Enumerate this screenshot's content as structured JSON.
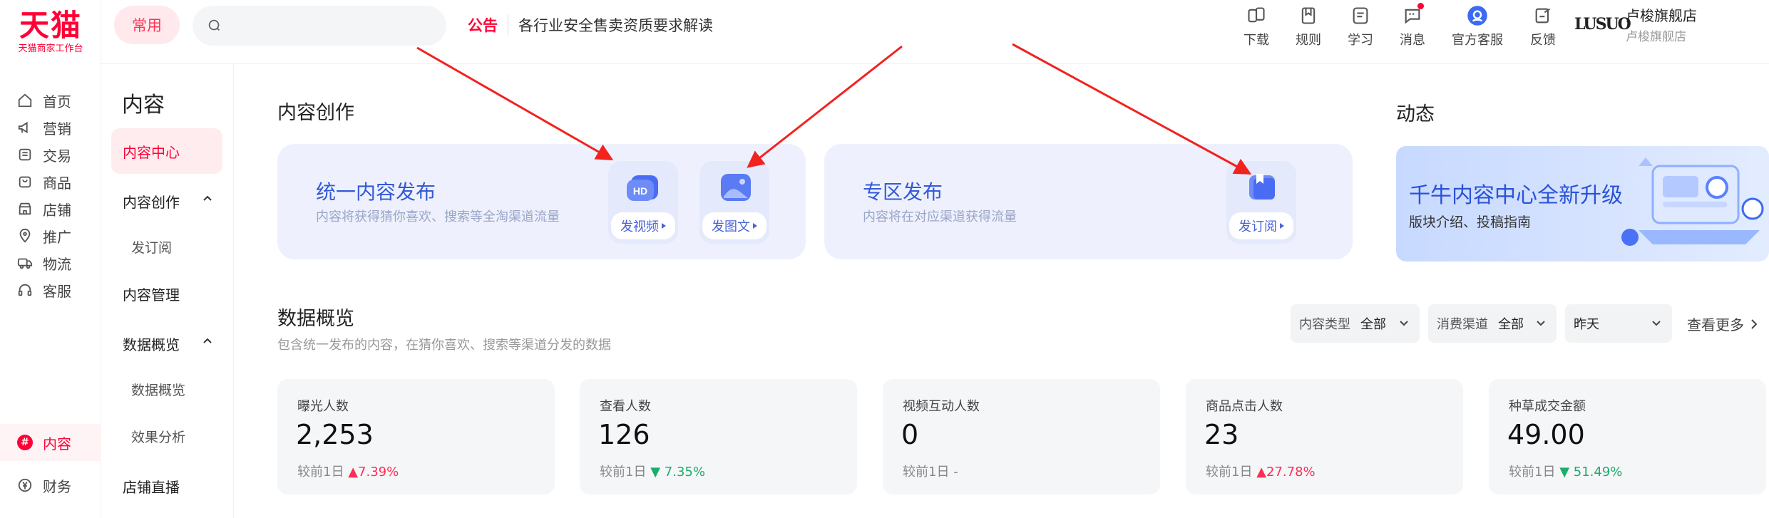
{
  "brand": {
    "logo_text": "天猫",
    "logo_sub": "天猫商家工作台",
    "accent": "#ff0036"
  },
  "rail": {
    "items": [
      {
        "label": "首页",
        "icon": "home-icon"
      },
      {
        "label": "营销",
        "icon": "megaphone-icon"
      },
      {
        "label": "交易",
        "icon": "receipt-icon"
      },
      {
        "label": "商品",
        "icon": "bag-icon"
      },
      {
        "label": "店铺",
        "icon": "shop-icon"
      },
      {
        "label": "推广",
        "icon": "location-pin-icon"
      },
      {
        "label": "物流",
        "icon": "truck-icon"
      },
      {
        "label": "客服",
        "icon": "headset-icon"
      },
      {
        "label": "内容",
        "icon": "hashtag-icon",
        "active": true
      },
      {
        "label": "财务",
        "icon": "yen-icon"
      }
    ]
  },
  "subnav": {
    "title": "内容",
    "items": [
      {
        "label": "内容中心",
        "active": true
      },
      {
        "label": "内容创作",
        "expanded": true
      },
      {
        "label": "发订阅",
        "child": true
      },
      {
        "label": "内容管理"
      },
      {
        "label": "数据概览",
        "expanded": true
      },
      {
        "label": "数据概览",
        "child": true
      },
      {
        "label": "效果分析",
        "child": true
      },
      {
        "label": "店铺直播"
      }
    ]
  },
  "topbar": {
    "common_label": "常用",
    "search_placeholder": "",
    "notice_tag": "公告",
    "notice_text": "各行业安全售卖资质要求解读",
    "tools": [
      {
        "label": "下载",
        "icon": "download-icon"
      },
      {
        "label": "规则",
        "icon": "rules-icon"
      },
      {
        "label": "学习",
        "icon": "study-icon"
      },
      {
        "label": "消息",
        "icon": "message-icon",
        "badge": true
      },
      {
        "label": "官方客服",
        "icon": "official-service-icon"
      },
      {
        "label": "反馈",
        "icon": "feedback-icon"
      }
    ],
    "store": {
      "logo_text": "LUSUO",
      "name": "卢梭旗舰店",
      "sub": "卢梭旗舰店"
    }
  },
  "creation": {
    "heading": "内容创作",
    "card1": {
      "title": "统一内容发布",
      "subtitle": "内容将获得猜你喜欢、搜索等全淘渠道流量",
      "video_label": "发视频",
      "image_label": "发图文"
    },
    "card2": {
      "title": "专区发布",
      "subtitle": "内容将在对应渠道获得流量",
      "subscribe_label": "发订阅"
    }
  },
  "news": {
    "heading": "动态",
    "promo_title": "千牛内容中心全新升级",
    "promo_subtitle": "版块介绍、投稿指南"
  },
  "overview": {
    "heading": "数据概览",
    "desc": "包含统一发布的内容，在猜你喜欢、搜索等渠道分发的数据",
    "filter1": {
      "key": "内容类型",
      "value": "全部"
    },
    "filter2": {
      "key": "消费渠道",
      "value": "全部"
    },
    "date": "昨天",
    "more": "查看更多",
    "stats": [
      {
        "label": "曝光人数",
        "value": "2,253",
        "compare": "较前1日",
        "delta": "7.39%",
        "dir": "up"
      },
      {
        "label": "查看人数",
        "value": "126",
        "compare": "较前1日",
        "delta": "7.35%",
        "dir": "down"
      },
      {
        "label": "视频互动人数",
        "value": "0",
        "compare": "较前1日",
        "delta": "-",
        "dir": "none"
      },
      {
        "label": "商品点击人数",
        "value": "23",
        "compare": "较前1日",
        "delta": "27.78%",
        "dir": "up"
      },
      {
        "label": "种草成交金额",
        "value": "49.00",
        "compare": "较前1日",
        "delta": "51.49%",
        "dir": "down"
      }
    ]
  },
  "colors": {
    "up": "#ff2d55",
    "down": "#1aad6b",
    "card_title": "#3359d6",
    "annotation_arrow": "#f2221f"
  }
}
